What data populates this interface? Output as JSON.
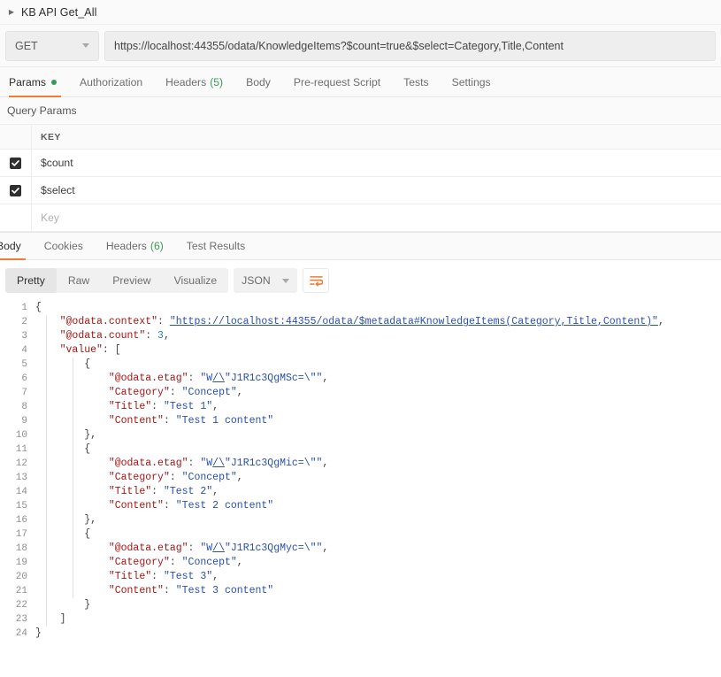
{
  "breadcrumb": {
    "caret_icon": "triangle-right-icon",
    "title": "KB API Get_All"
  },
  "request": {
    "method": "GET",
    "method_caret_icon": "chevron-down-icon",
    "url": "https://localhost:44355/odata/KnowledgeItems?$count=true&$select=Category,Title,Content",
    "tabs": [
      {
        "label": "Params",
        "active": true,
        "badge_dot": true
      },
      {
        "label": "Authorization",
        "active": false
      },
      {
        "label": "Headers",
        "count": "(5)",
        "active": false
      },
      {
        "label": "Body",
        "active": false
      },
      {
        "label": "Pre-request Script",
        "active": false
      },
      {
        "label": "Tests",
        "active": false
      },
      {
        "label": "Settings",
        "active": false
      }
    ]
  },
  "query_params": {
    "section_label": "Query Params",
    "columns": [
      "KEY"
    ],
    "rows": [
      {
        "checked": true,
        "key": "$count"
      },
      {
        "checked": true,
        "key": "$select"
      },
      {
        "checked": false,
        "key": "Key",
        "placeholder": true
      }
    ]
  },
  "response": {
    "tabs": [
      {
        "label": "Body",
        "active": true
      },
      {
        "label": "Cookies",
        "active": false
      },
      {
        "label": "Headers",
        "count": "(6)",
        "active": false
      },
      {
        "label": "Test Results",
        "active": false
      }
    ],
    "format_tabs": [
      {
        "label": "Pretty",
        "active": true
      },
      {
        "label": "Raw",
        "active": false
      },
      {
        "label": "Preview",
        "active": false
      },
      {
        "label": "Visualize",
        "active": false
      }
    ],
    "content_type": "JSON",
    "content_type_caret_icon": "chevron-down-icon",
    "wrap_button_icon": "word-wrap-icon",
    "accent_color": "#ef7c35",
    "body_json": {
      "@odata.context": "https://localhost:44355/odata/$metadata#KnowledgeItems(Category,Title,Content)",
      "@odata.count": 3,
      "value": [
        {
          "@odata.etag": "W/\\\"J1R1c3QgMSc=\\\"",
          "Category": "Concept",
          "Title": "Test 1",
          "Content": "Test 1 content"
        },
        {
          "@odata.etag": "W/\\\"J1R1c3QgMic=\\\"",
          "Category": "Concept",
          "Title": "Test 2",
          "Content": "Test 2 content"
        },
        {
          "@odata.etag": "W/\\\"J1R1c3QgMyc=\\\"",
          "Category": "Concept",
          "Title": "Test 3",
          "Content": "Test 3 content"
        }
      ]
    },
    "line_numbers": [
      1,
      2,
      3,
      4,
      5,
      6,
      7,
      8,
      9,
      10,
      11,
      12,
      13,
      14,
      15,
      16,
      17,
      18,
      19,
      20,
      21,
      22,
      23,
      24
    ]
  }
}
